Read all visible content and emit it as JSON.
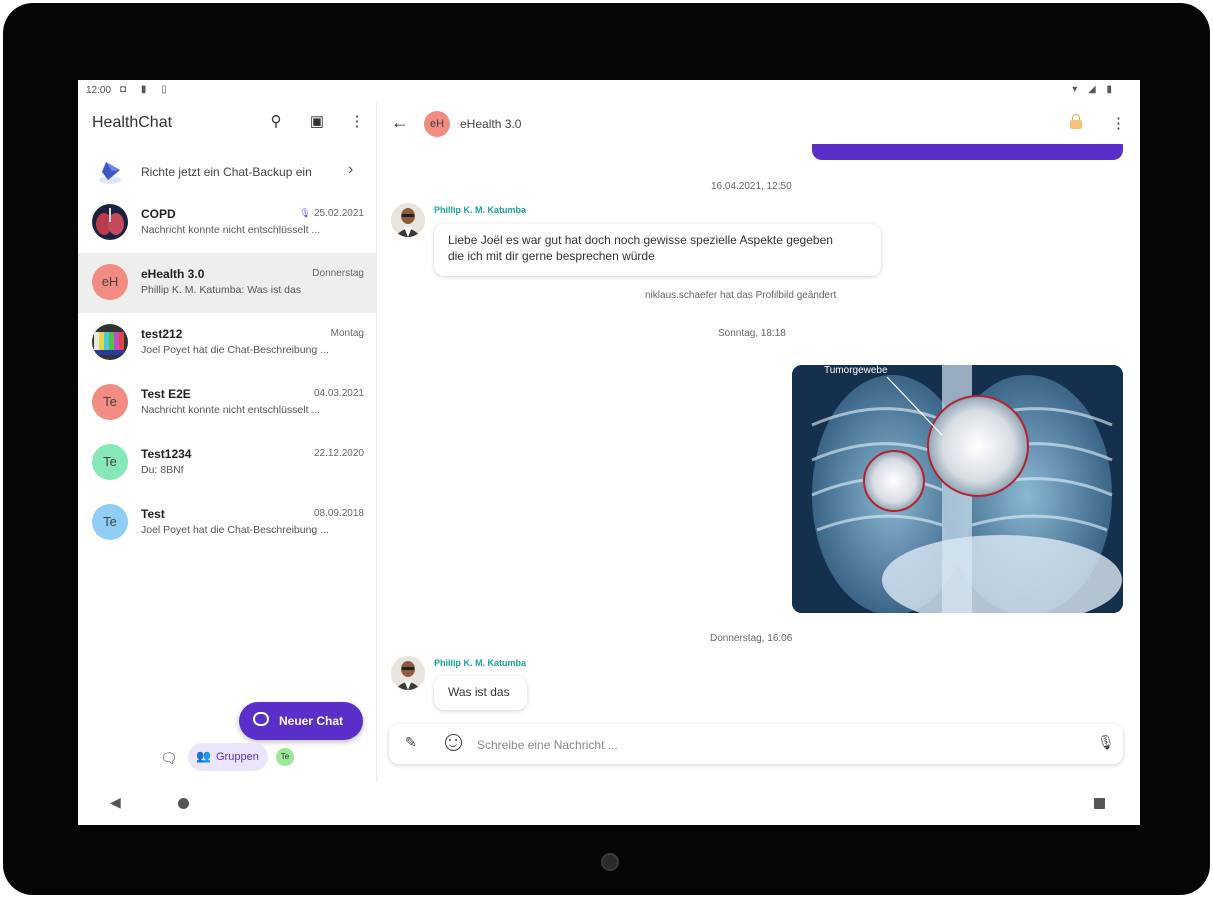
{
  "status_bar": {
    "time": "12:00",
    "left_icons": "◘ ▮ ▯",
    "right_icons": "▾ ◢ ▮"
  },
  "sidebar": {
    "app_title": "HealthChat",
    "search_icon": "⚲",
    "camera_icon": "▣",
    "more_icon": "⋮",
    "backup": {
      "text": "Richte jetzt ein Chat-Backup ein",
      "chevron": "›"
    },
    "chats": [
      {
        "avatar": "",
        "name": "COPD",
        "date": "25.02.2021",
        "preview": "Nachricht konnte nicht entschlüsselt ...",
        "mic": true
      },
      {
        "avatar": "eH",
        "name": "eHealth 3.0",
        "date": "Donnerstag",
        "preview": "Phillip K. M. Katumba: Was ist das",
        "active": true
      },
      {
        "avatar": "",
        "name": "test212",
        "date": "Montag",
        "preview": "Joel Poyet hat die Chat-Beschreibung ..."
      },
      {
        "avatar": "Te",
        "name": "Test E2E",
        "date": "04.03.2021",
        "preview": "Nachricht konnte nicht entschlüsselt ..."
      },
      {
        "avatar": "Te",
        "name": "Test1234",
        "date": "22.12.2020",
        "preview": "Du: 8BNf"
      },
      {
        "avatar": "Te",
        "name": "Test",
        "date": "08.09.2018",
        "preview": "Joel Poyet hat die Chat-Beschreibung ..."
      }
    ],
    "new_chat_label": "Neuer Chat",
    "tabs": {
      "chats_icon": "🗨",
      "groups_label": "Gruppen",
      "groups_icon": "👥",
      "user_initials": "Te"
    }
  },
  "chat": {
    "back_icon": "←",
    "avatar": "eH",
    "title": "eHealth 3.0",
    "more_icon": "⋮",
    "timestamps": [
      "16.04.2021, 12:50",
      "Sonntag, 18:18",
      "Donnerstag, 16:06"
    ],
    "messages": [
      {
        "sender": "Phillip K. M. Katumba",
        "lines": [
          "Liebe Joël es war gut hat doch noch gewisse spezielle Aspekte gegeben",
          "die ich mit dir gerne besprechen würde"
        ]
      },
      {
        "sender": "Phillip K. M. Katumba",
        "lines": [
          "Was ist das"
        ]
      }
    ],
    "system_note": "niklaus.schaefer hat das Profilbild geändert",
    "image_caption": "Tumorgewebe",
    "composer": {
      "placeholder": "Schreibe eine Nachricht ...",
      "attach_icon": "✎",
      "mic_icon": "🎙"
    }
  },
  "navigation": {
    "back": "◀"
  },
  "colors": {
    "accent": "#5a2fc9",
    "sender": "#1aa39a",
    "avatar_red": "#f28b82",
    "avatar_green": "#86e8b8",
    "avatar_blue": "#8fcdf5",
    "lock": "#f2a54a"
  }
}
